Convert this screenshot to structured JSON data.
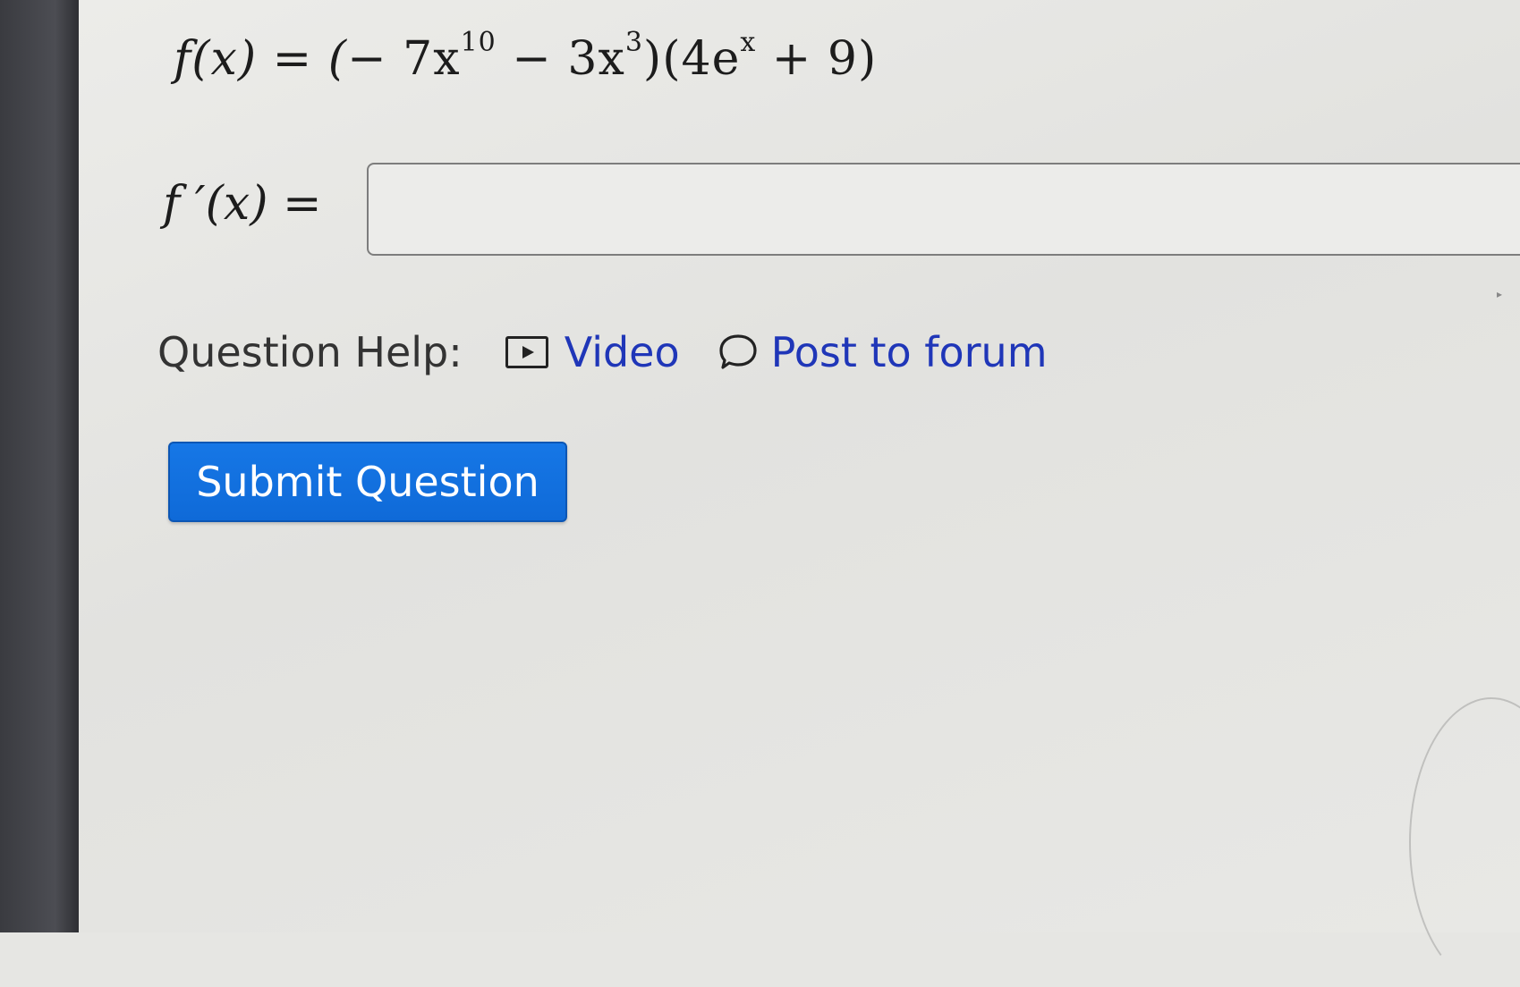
{
  "question": {
    "function_name": "f(x) = (",
    "term1_coef": "− 7x",
    "term1_exp": "10",
    "term2": " − 3x",
    "term2_exp": "3",
    "factor2_open": ")(4e",
    "factor2_exp": "x",
    "factor2_rest": " + 9)",
    "answer_label": "f ′(x) =",
    "answer_value": ""
  },
  "help": {
    "label": "Question Help:",
    "video_label": "Video",
    "forum_label": "Post to forum"
  },
  "submit": {
    "label": "Submit Question"
  },
  "colors": {
    "link": "#1f36b8",
    "button": "#1677e6"
  },
  "icons": {
    "video": "video-play-icon",
    "forum": "speech-bubble-icon"
  }
}
